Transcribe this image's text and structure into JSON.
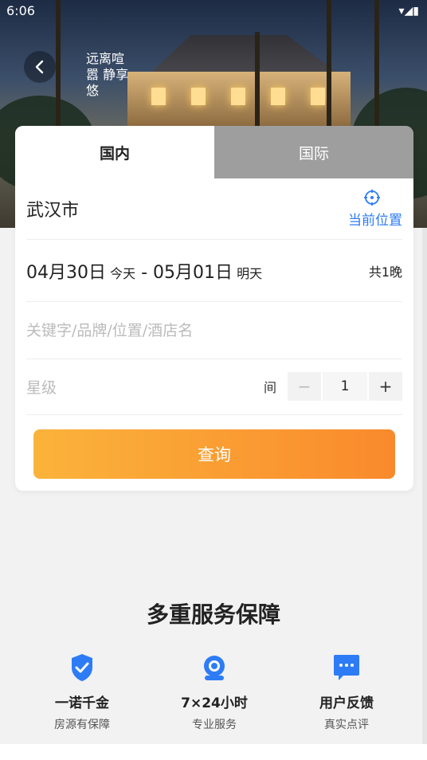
{
  "status_bar": {
    "time": "6:06",
    "right_icons": "▾◢▮"
  },
  "hero": {
    "calligraphy": "远离喧嚣 静享悠"
  },
  "tabs": [
    {
      "label": "国内"
    },
    {
      "label": "国际"
    }
  ],
  "search_form": {
    "city": "武汉市",
    "locate_label": "当前位置",
    "checkin_date": "04月30日",
    "checkin_tag": "今天",
    "date_separator": " - ",
    "checkout_date": "05月01日",
    "checkout_tag": "明天",
    "nights": "共1晚",
    "keyword_placeholder": "关键字/品牌/位置/酒店名",
    "star_placeholder": "星级",
    "room_label": "间",
    "room_minus": "−",
    "room_count": "1",
    "room_plus": "+",
    "submit_label": "查询"
  },
  "services": {
    "title": "多重服务保障",
    "items": [
      {
        "icon": "shield-check-icon",
        "title": "一诺千金",
        "subtitle": "房源有保障"
      },
      {
        "icon": "headset-support-icon",
        "title": "7×24小时",
        "subtitle": "专业服务"
      },
      {
        "icon": "chat-bubble-icon",
        "title": "用户反馈",
        "subtitle": "真实点评"
      }
    ]
  },
  "colors": {
    "accent_blue": "#2d7cf6",
    "button_start": "#fbb33b",
    "button_end": "#f98a2c"
  }
}
